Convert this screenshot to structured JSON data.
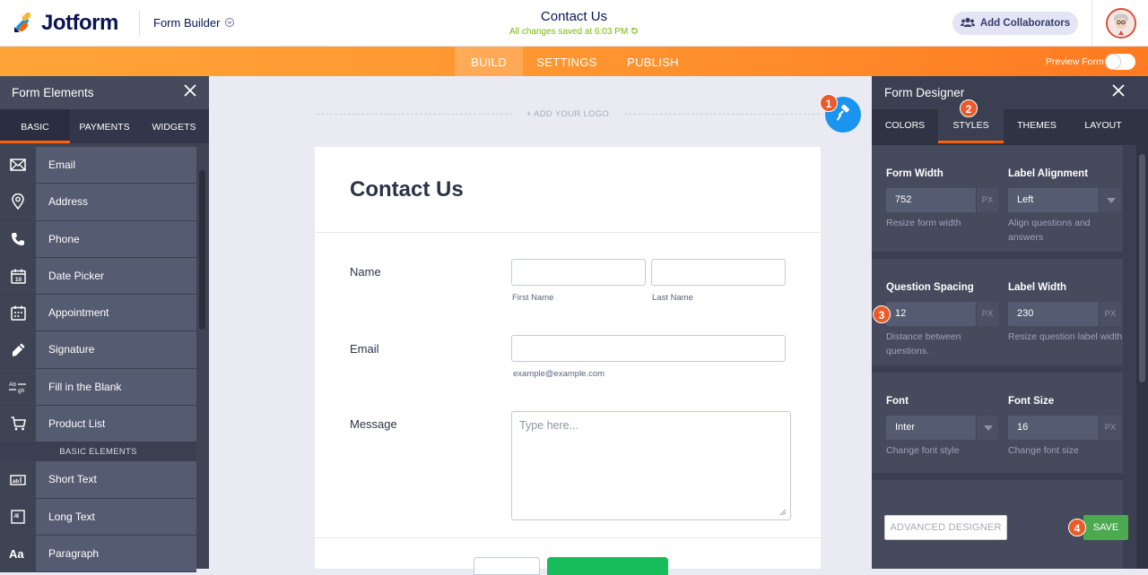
{
  "header": {
    "brand": "Jotform",
    "menu_label": "Form Builder",
    "form_title": "Contact Us",
    "saved_status": "All changes saved at 6:03 PM",
    "collab_label": "Add Collaborators"
  },
  "nav": {
    "tabs": [
      "BUILD",
      "SETTINGS",
      "PUBLISH"
    ],
    "active_tab": "BUILD",
    "preview_label": "Preview Form",
    "preview_on": false
  },
  "left_panel": {
    "title": "Form Elements",
    "tabs": [
      "BASIC",
      "PAYMENTS",
      "WIDGETS"
    ],
    "active_tab": "BASIC",
    "items": [
      {
        "label": "Email",
        "icon": "envelope-icon"
      },
      {
        "label": "Address",
        "icon": "map-pin-icon"
      },
      {
        "label": "Phone",
        "icon": "phone-icon"
      },
      {
        "label": "Date Picker",
        "icon": "calendar-icon"
      },
      {
        "label": "Appointment",
        "icon": "appointment-icon"
      },
      {
        "label": "Signature",
        "icon": "signature-icon"
      },
      {
        "label": "Fill in the Blank",
        "icon": "fill-blank-icon"
      },
      {
        "label": "Product List",
        "icon": "cart-icon"
      }
    ],
    "section_label": "BASIC ELEMENTS",
    "basic_items": [
      {
        "label": "Short Text",
        "icon": "short-text-icon"
      },
      {
        "label": "Long Text",
        "icon": "long-text-icon"
      },
      {
        "label": "Paragraph",
        "icon": "paragraph-icon"
      }
    ]
  },
  "canvas": {
    "add_logo": "+ ADD YOUR LOGO",
    "form_heading": "Contact Us",
    "questions": {
      "name_label": "Name",
      "first_name_sublabel": "First Name",
      "last_name_sublabel": "Last Name",
      "email_label": "Email",
      "email_sublabel": "example@example.com",
      "message_label": "Message",
      "message_placeholder": "Type here..."
    }
  },
  "right_panel": {
    "title": "Form Designer",
    "tabs": [
      "COLORS",
      "STYLES",
      "THEMES",
      "LAYOUT"
    ],
    "active_tab": "STYLES",
    "fields": {
      "form_width": {
        "label": "Form Width",
        "value": "752",
        "unit": "PX",
        "help": "Resize form width"
      },
      "label_alignment": {
        "label": "Label Alignment",
        "value": "Left",
        "help": "Align questions and answers"
      },
      "question_spacing": {
        "label": "Question Spacing",
        "value": "12",
        "unit": "PX",
        "help": "Distance between questions."
      },
      "label_width": {
        "label": "Label Width",
        "value": "230",
        "unit": "PX",
        "help": "Resize question label width"
      },
      "font": {
        "label": "Font",
        "value": "Inter",
        "help": "Change font style"
      },
      "font_size": {
        "label": "Font Size",
        "value": "16",
        "unit": "PX",
        "help": "Change font size"
      }
    },
    "advanced_label": "ADVANCED DESIGNER",
    "save_label": "SAVE"
  },
  "callouts": [
    "1",
    "2",
    "3",
    "4"
  ],
  "colors": {
    "brand_orange": "#ff6100",
    "nav_gradient": "#ff9530",
    "accent_blue": "#1b94ef",
    "save_green": "#4ba94e",
    "callout": "#ea5b2a"
  }
}
